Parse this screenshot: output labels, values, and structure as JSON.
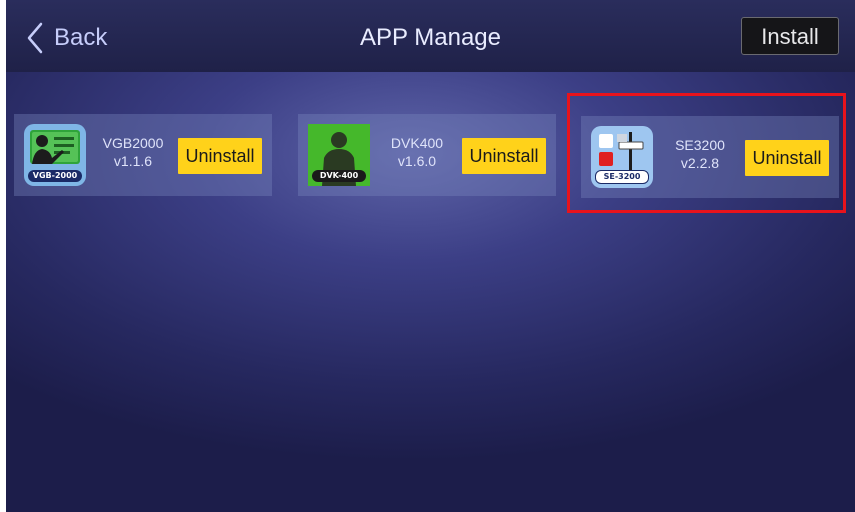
{
  "header": {
    "back_label": "Back",
    "title": "APP Manage",
    "install_label": "Install"
  },
  "apps": [
    {
      "name": "VGB2000",
      "version": "v1.1.6",
      "icon_label": "VGB-2000",
      "action_label": "Uninstall",
      "icon": "presenter-board-icon"
    },
    {
      "name": "DVK400",
      "version": "v1.6.0",
      "icon_label": "DVK-400",
      "action_label": "Uninstall",
      "icon": "greenscreen-person-icon"
    },
    {
      "name": "SE3200",
      "version": "v2.2.8",
      "icon_label": "SE-3200",
      "action_label": "Uninstall",
      "icon": "switcher-fader-icon"
    }
  ],
  "colors": {
    "uninstall_button": "#ffd21a",
    "highlight_box": "#e8131c",
    "back_text": "#c6cdfa"
  }
}
